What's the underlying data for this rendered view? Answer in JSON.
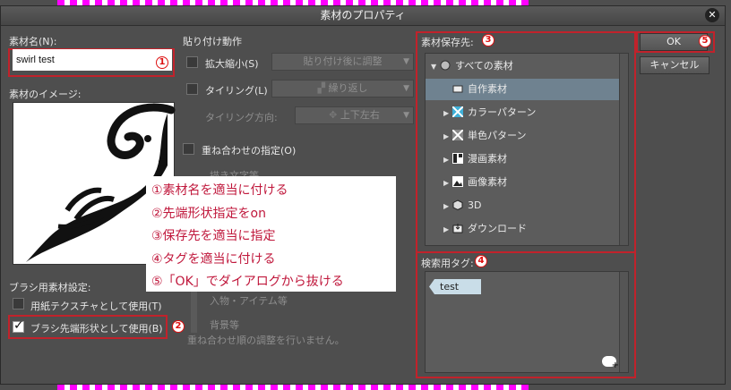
{
  "window": {
    "title": "素材のプロパティ",
    "close": "✕"
  },
  "left": {
    "name_label": "素材名(N):",
    "name_value": "swirl test",
    "image_label": "素材のイメージ:",
    "brush_section_label": "ブラシ用素材設定:",
    "paper_texture_label": "用紙テクスチャとして使用(T)",
    "paper_texture_checked": false,
    "brush_tip_label": "ブラシ先端形状として使用(B)",
    "brush_tip_checked": true
  },
  "paste": {
    "section_label": "貼り付け動作",
    "scale_label": "拡大縮小(S)",
    "scale_combo": "貼り付け後に調整",
    "tiling_label": "タイリング(L)",
    "tiling_combo": "繰り返し",
    "tiling_dir_label": "タイリング方向:",
    "tiling_dir_combo": "上下左右",
    "overlay_label": "重ね合わせの指定(O)",
    "faded_items": [
      "描き文字等",
      "入物・アイテム等",
      "背景等"
    ],
    "faded_note": "重ね合わせ順の調整を行いません。"
  },
  "save": {
    "label": "素材保存先:",
    "tree": [
      {
        "label": "すべての素材",
        "icon": "globe-icon",
        "expander": "▼",
        "indent": 0,
        "selected": false
      },
      {
        "label": "自作素材",
        "icon": "folder-icon",
        "expander": "",
        "indent": 1,
        "selected": true
      },
      {
        "label": "カラーパターン",
        "icon": "color-pattern-icon",
        "expander": "▶",
        "indent": 1,
        "selected": false
      },
      {
        "label": "単色パターン",
        "icon": "mono-pattern-icon",
        "expander": "▶",
        "indent": 1,
        "selected": false
      },
      {
        "label": "漫画素材",
        "icon": "manga-icon",
        "expander": "▶",
        "indent": 1,
        "selected": false
      },
      {
        "label": "画像素材",
        "icon": "image-icon",
        "expander": "▶",
        "indent": 1,
        "selected": false
      },
      {
        "label": "3D",
        "icon": "cube-icon",
        "expander": "▶",
        "indent": 1,
        "selected": false
      },
      {
        "label": "ダウンロード",
        "icon": "download-icon",
        "expander": "▶",
        "indent": 1,
        "selected": false
      }
    ]
  },
  "tags": {
    "label": "検索用タグ:",
    "items": [
      "test"
    ]
  },
  "buttons": {
    "ok": "OK",
    "cancel": "キャンセル"
  },
  "markers": {
    "m1": "1",
    "m2": "2",
    "m3": "3",
    "m4": "4",
    "m5": "5"
  },
  "instructions": [
    "①素材名を適当に付ける",
    "②先端形状指定をon",
    "③保存先を適当に指定",
    "④タグを適当に付ける",
    "⑤「OK」でダイアログから抜ける"
  ],
  "colors": {
    "annotation_red": "#c1222b",
    "selected_row": "#6f8290",
    "dialog_bg": "#4e4e4e"
  }
}
